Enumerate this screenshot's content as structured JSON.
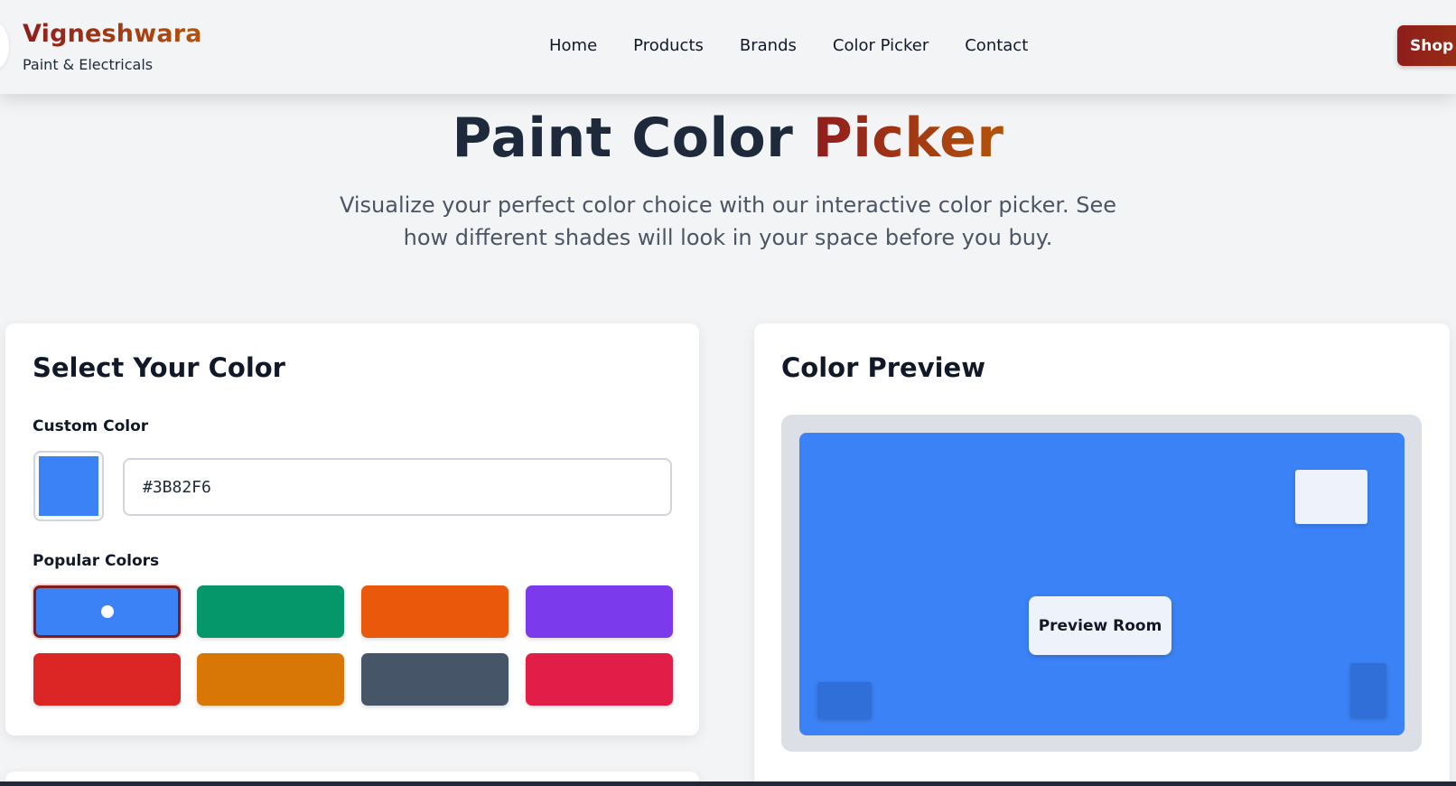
{
  "header": {
    "brand_name": "Vigneshwara",
    "brand_sub": "Paint & Electricals",
    "nav": [
      "Home",
      "Products",
      "Brands",
      "Color Picker",
      "Contact"
    ],
    "shop_button": "Shop Now"
  },
  "hero": {
    "title_main": "Paint Color",
    "title_accent": "Picker",
    "description": "Visualize your perfect color choice with our interactive color picker. See how different shades will look in your space before you buy."
  },
  "selector": {
    "title": "Select Your Color",
    "custom_label": "Custom Color",
    "hex_value": "#3B82F6",
    "current_color": "#3B82F6",
    "popular_label": "Popular Colors",
    "popular_colors": [
      "#3B82F6",
      "#059669",
      "#EA580C",
      "#7C3AED",
      "#DC2626",
      "#D97706",
      "#475569",
      "#E11D48"
    ],
    "selected_index": 0
  },
  "preview": {
    "title": "Color Preview",
    "room_label": "Preview Room",
    "room_color": "#3B82F6"
  },
  "colors": {
    "brand_gradient_start": "#8F1D1D",
    "brand_gradient_end": "#B45309",
    "page_background": "#F3F4F6"
  },
  "icons": [
    "selected-dot-icon"
  ]
}
